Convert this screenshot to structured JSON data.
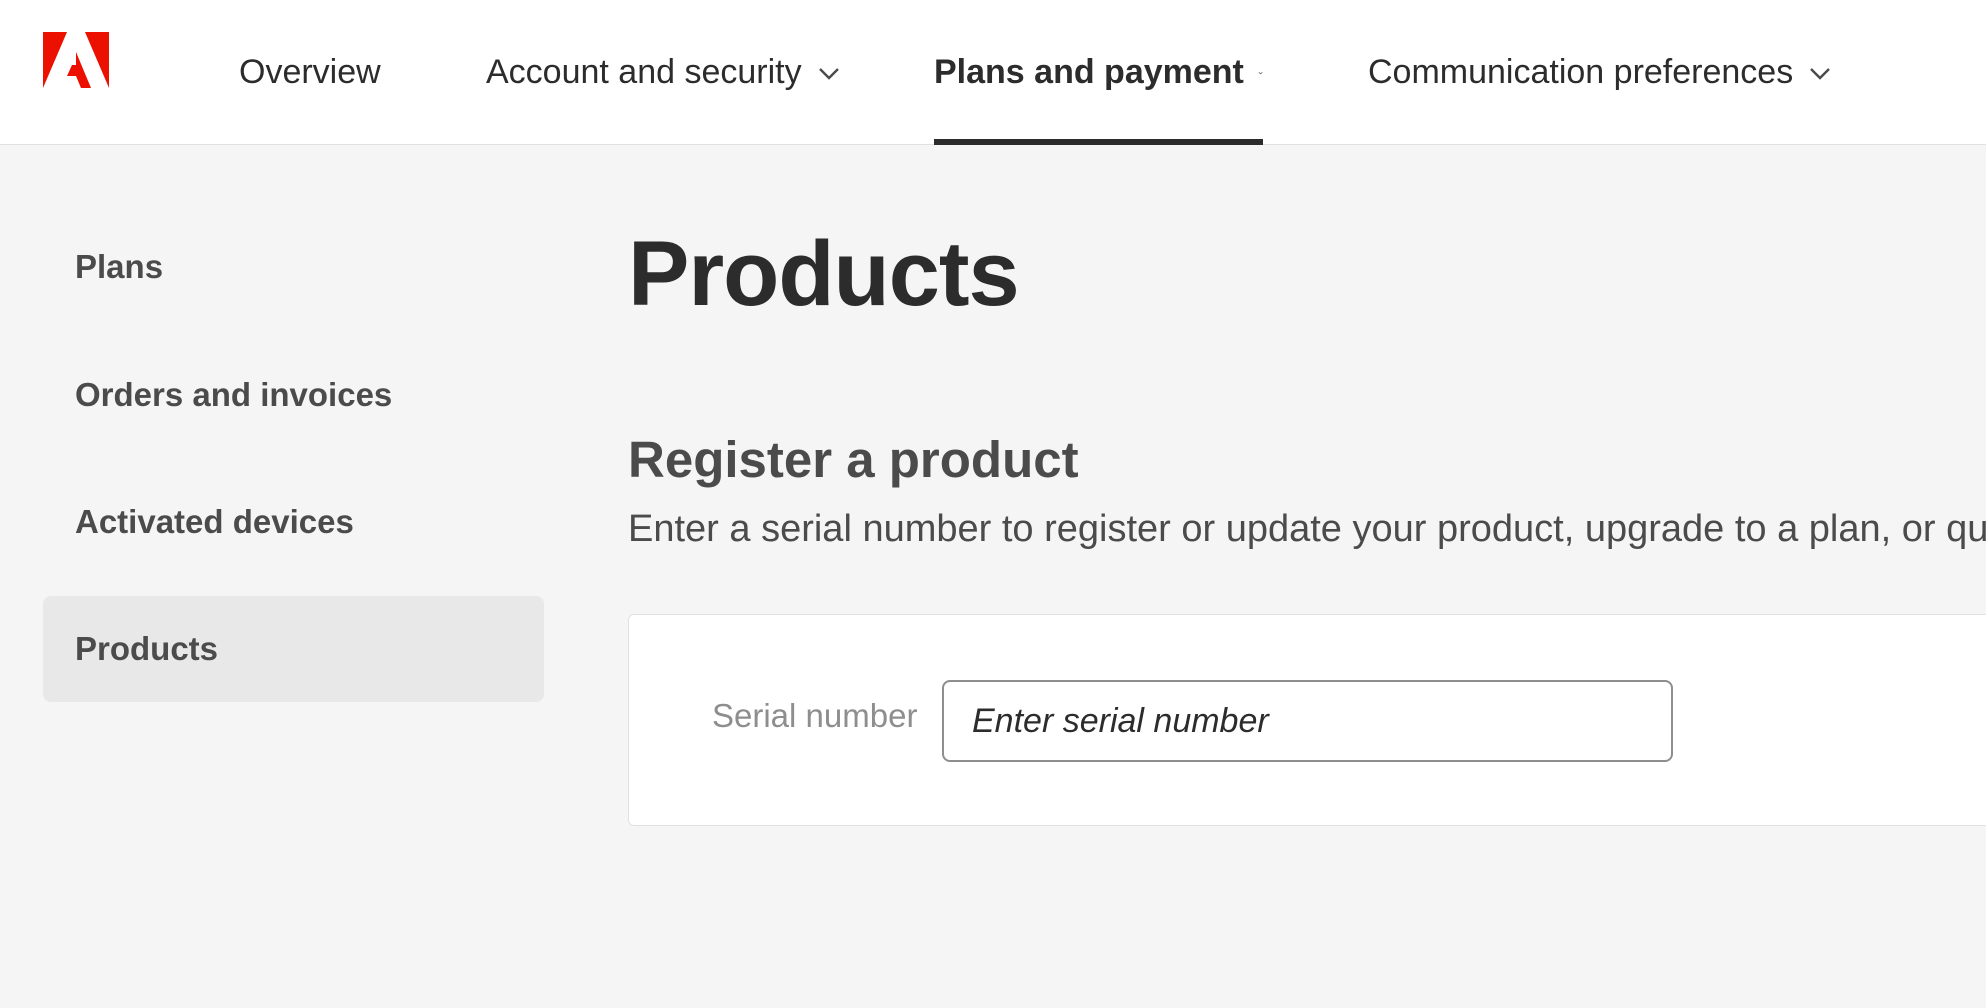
{
  "brand": {
    "logo_icon": "adobe-logo-icon",
    "color": "#eb1000"
  },
  "nav": {
    "overview": "Overview",
    "account": "Account and security",
    "plans": "Plans and payment",
    "communication": "Communication preferences",
    "active_tab": "Plans and payment"
  },
  "sidebar": {
    "items": [
      {
        "label": "Plans"
      },
      {
        "label": "Orders and invoices"
      },
      {
        "label": "Activated devices"
      },
      {
        "label": "Products",
        "selected": true
      }
    ]
  },
  "main": {
    "title": "Products",
    "section_title": "Register a product",
    "section_desc": "Enter a serial number to register or update your product, upgrade to a plan, or qu",
    "serial_label": "Serial number",
    "serial_placeholder": "Enter serial number",
    "serial_value": ""
  }
}
